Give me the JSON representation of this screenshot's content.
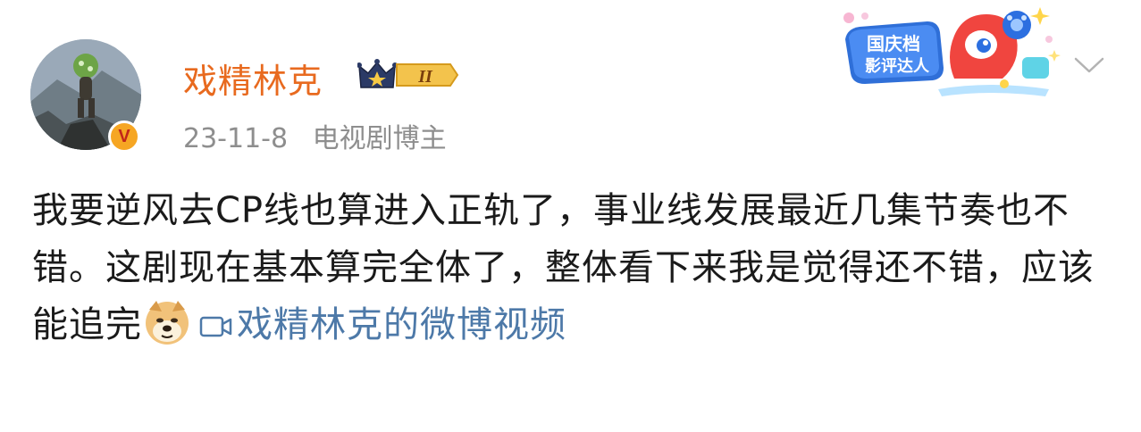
{
  "author": {
    "name": "戏精林克",
    "avatar_icon": "avatar-mountain-character",
    "verified_icon": "verified-v-badge",
    "verified_letter": "V",
    "rank_level": "II",
    "verified_color": "#f6a623"
  },
  "meta": {
    "date": "23-11-8",
    "tag": "电视剧博主"
  },
  "event_badge": {
    "line1": "国庆档",
    "line2": "影评达人"
  },
  "menu_icon": "chevron-down-icon",
  "post": {
    "text": "我要逆风去CP线也算进入正轨了，事业线发展最近几集节奏也不错。这剧现在基本算完全体了，整体看下来我是觉得还不错，应该能追完",
    "emoji": "doge-emoji",
    "video_link_label": "戏精林克的微博视频",
    "link_color": "#4d79a8"
  },
  "colors": {
    "username": "#e86a1f",
    "meta": "#8e8e8e",
    "text": "#1a1a1a"
  }
}
